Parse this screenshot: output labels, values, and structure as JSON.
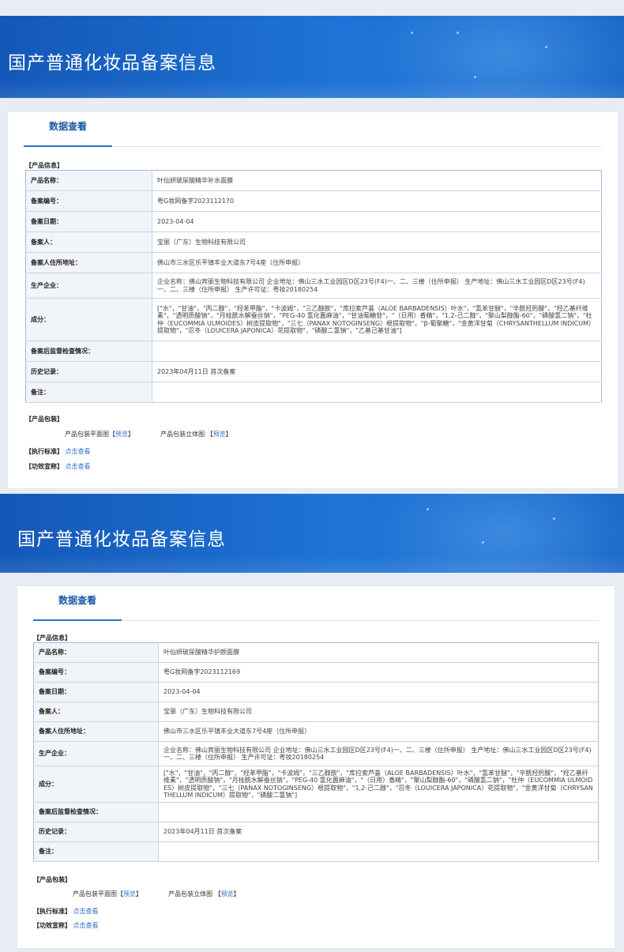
{
  "panels": [
    {
      "banner_title": "国产普通化妆品备案信息",
      "tab_label": "数据查看",
      "section_product_info": "【产品信息】",
      "rows": [
        {
          "label": "产品名称：",
          "value": "叶仙妍玻尿酸精华补水面膜"
        },
        {
          "label": "备案编号：",
          "value": "粤G妆网备字2023112170"
        },
        {
          "label": "备案日期：",
          "value": "2023-04-04"
        },
        {
          "label": "备案人：",
          "value": "宝丽（广东）生物科技有限公司"
        },
        {
          "label": "备案人住所地址：",
          "value": "佛山市三水区乐平镇丰业大道东7号4座（住所申报）"
        },
        {
          "label": "生产企业：",
          "value": "企业名称：佛山宾丽生物科技有限公司 企业地址：佛山三水工业园区D区23号(F4)一、二、三楼（住所申报） 生产地址：佛山三水工业园区D区23号(F4)一、二、三楼（住所申报） 生产许可证：粤妆20180254"
        },
        {
          "label": "成分：",
          "value": "[\"水\"，\"甘油\"，\"丙二醇\"，\"羟苯甲酯\"，\"卡波姆\"，\"三乙醇胺\"，\"库拉索芦荟（ALOE BARBADENSIS）叶水\"，\"氢苯甘醚\"，\"辛酰羟肟酸\"，\"羟乙基纤维素\"，\"透明质酸钠\"，\"月桂酰水解蚕丝钠\"，\"PEG-40 氢化蓖麻油\"，\"甘油葡糖苷\"，\"（日用）香精\"，\"1,2-己二醇\"，\"聚山梨醇酯-60\"，\"磷酸氢二钠\"，\"杜仲（EUCOMMIA ULMOIDES）树皮提取物\"，\"三七（PANAX NOTOGINSENG）根提取物\"，\"β-葡聚糖\"，\"金黄洋甘菊（CHRYSANTHELLUM INDICUM）提取物\"，\"忍冬（LOUICERA JAPONICA）花提取物\"，\"磷酸二氢钠\"，\"乙基己基甘油\"]"
        },
        {
          "label": "备案后监督检查情况：",
          "value": ""
        },
        {
          "label": "历史记录：",
          "value": "2023年04月11日 首次备案"
        },
        {
          "label": "备注：",
          "value": ""
        }
      ],
      "section_packaging": "【产品包装】",
      "pack_flat_label": "产品包装平面图",
      "pack_3d_label": "产品包装立体图",
      "preview_label": "预览",
      "standard_label": "【执行标准】",
      "efficacy_label": "【功效宣称】",
      "view_link": "点击查看"
    },
    {
      "banner_title": "国产普通化妆品备案信息",
      "tab_label": "数据查看",
      "section_product_info": "【产品信息】",
      "rows": [
        {
          "label": "产品名称：",
          "value": "叶仙妍玻尿酸精华护颜面膜"
        },
        {
          "label": "备案编号：",
          "value": "粤G妆网备字2023112169"
        },
        {
          "label": "备案日期：",
          "value": "2023-04-04"
        },
        {
          "label": "备案人：",
          "value": "宝丽（广东）生物科技有限公司"
        },
        {
          "label": "备案人住所地址：",
          "value": "佛山市三水区乐平镇丰业大道东7号4座（住所申报）"
        },
        {
          "label": "生产企业：",
          "value": "企业名称：佛山宾丽生物科技有限公司 企业地址：佛山三水工业园区D区23号(F4)一、二、三楼（住所申报） 生产地址：佛山三水工业园区D区23号(F4)一、二、三楼（住所申报） 生产许可证：粤妆20180254"
        },
        {
          "label": "成分：",
          "value": "[\"水\"，\"甘油\"，\"丙二醇\"，\"羟苯甲酯\"，\"卡波姆\"，\"三乙醇胺\"，\"库拉索芦荟（ALOE BARBADENSIS）叶水\"，\"氢苯甘醚\"，\"辛酰羟肟酸\"，\"羟乙基纤维素\"，\"透明质酸钠\"，\"月桂酰水解蚕丝钠\"，\"PEG-40 氢化蓖麻油\"，\"（日用）香精\"，\"聚山梨醇酯-60\"，\"磷酸氢二钠\"，\"杜仲（EUCOMMIA ULMOIDES）树皮提取物\"，\"三七（PANAX NOTOGINSENG）根提取物\"，\"1,2-己二醇\"，\"忍冬（LOUICERA JAPONICA）花提取物\"，\"金黄洋甘菊（CHRYSANTHELLUM INDICUM）提取物\"，\"磷酸二氢钠\"]"
        },
        {
          "label": "备案后监督检查情况：",
          "value": ""
        },
        {
          "label": "历史记录：",
          "value": "2023年04月11日 首次备案"
        },
        {
          "label": "备注：",
          "value": ""
        }
      ],
      "section_packaging": "【产品包装】",
      "pack_flat_label": "产品包装平面图",
      "pack_3d_label": "产品包装立体图",
      "preview_label": "预览",
      "standard_label": "【执行标准】",
      "efficacy_label": "【功效宣称】",
      "view_link": "点击查看"
    }
  ],
  "colors": {
    "banner": "#1e74d6",
    "accent": "#2a6fc9",
    "tab_text": "#1a5aa8",
    "key_bg": "#f1f4f8",
    "table_border": "#9fbde0"
  }
}
